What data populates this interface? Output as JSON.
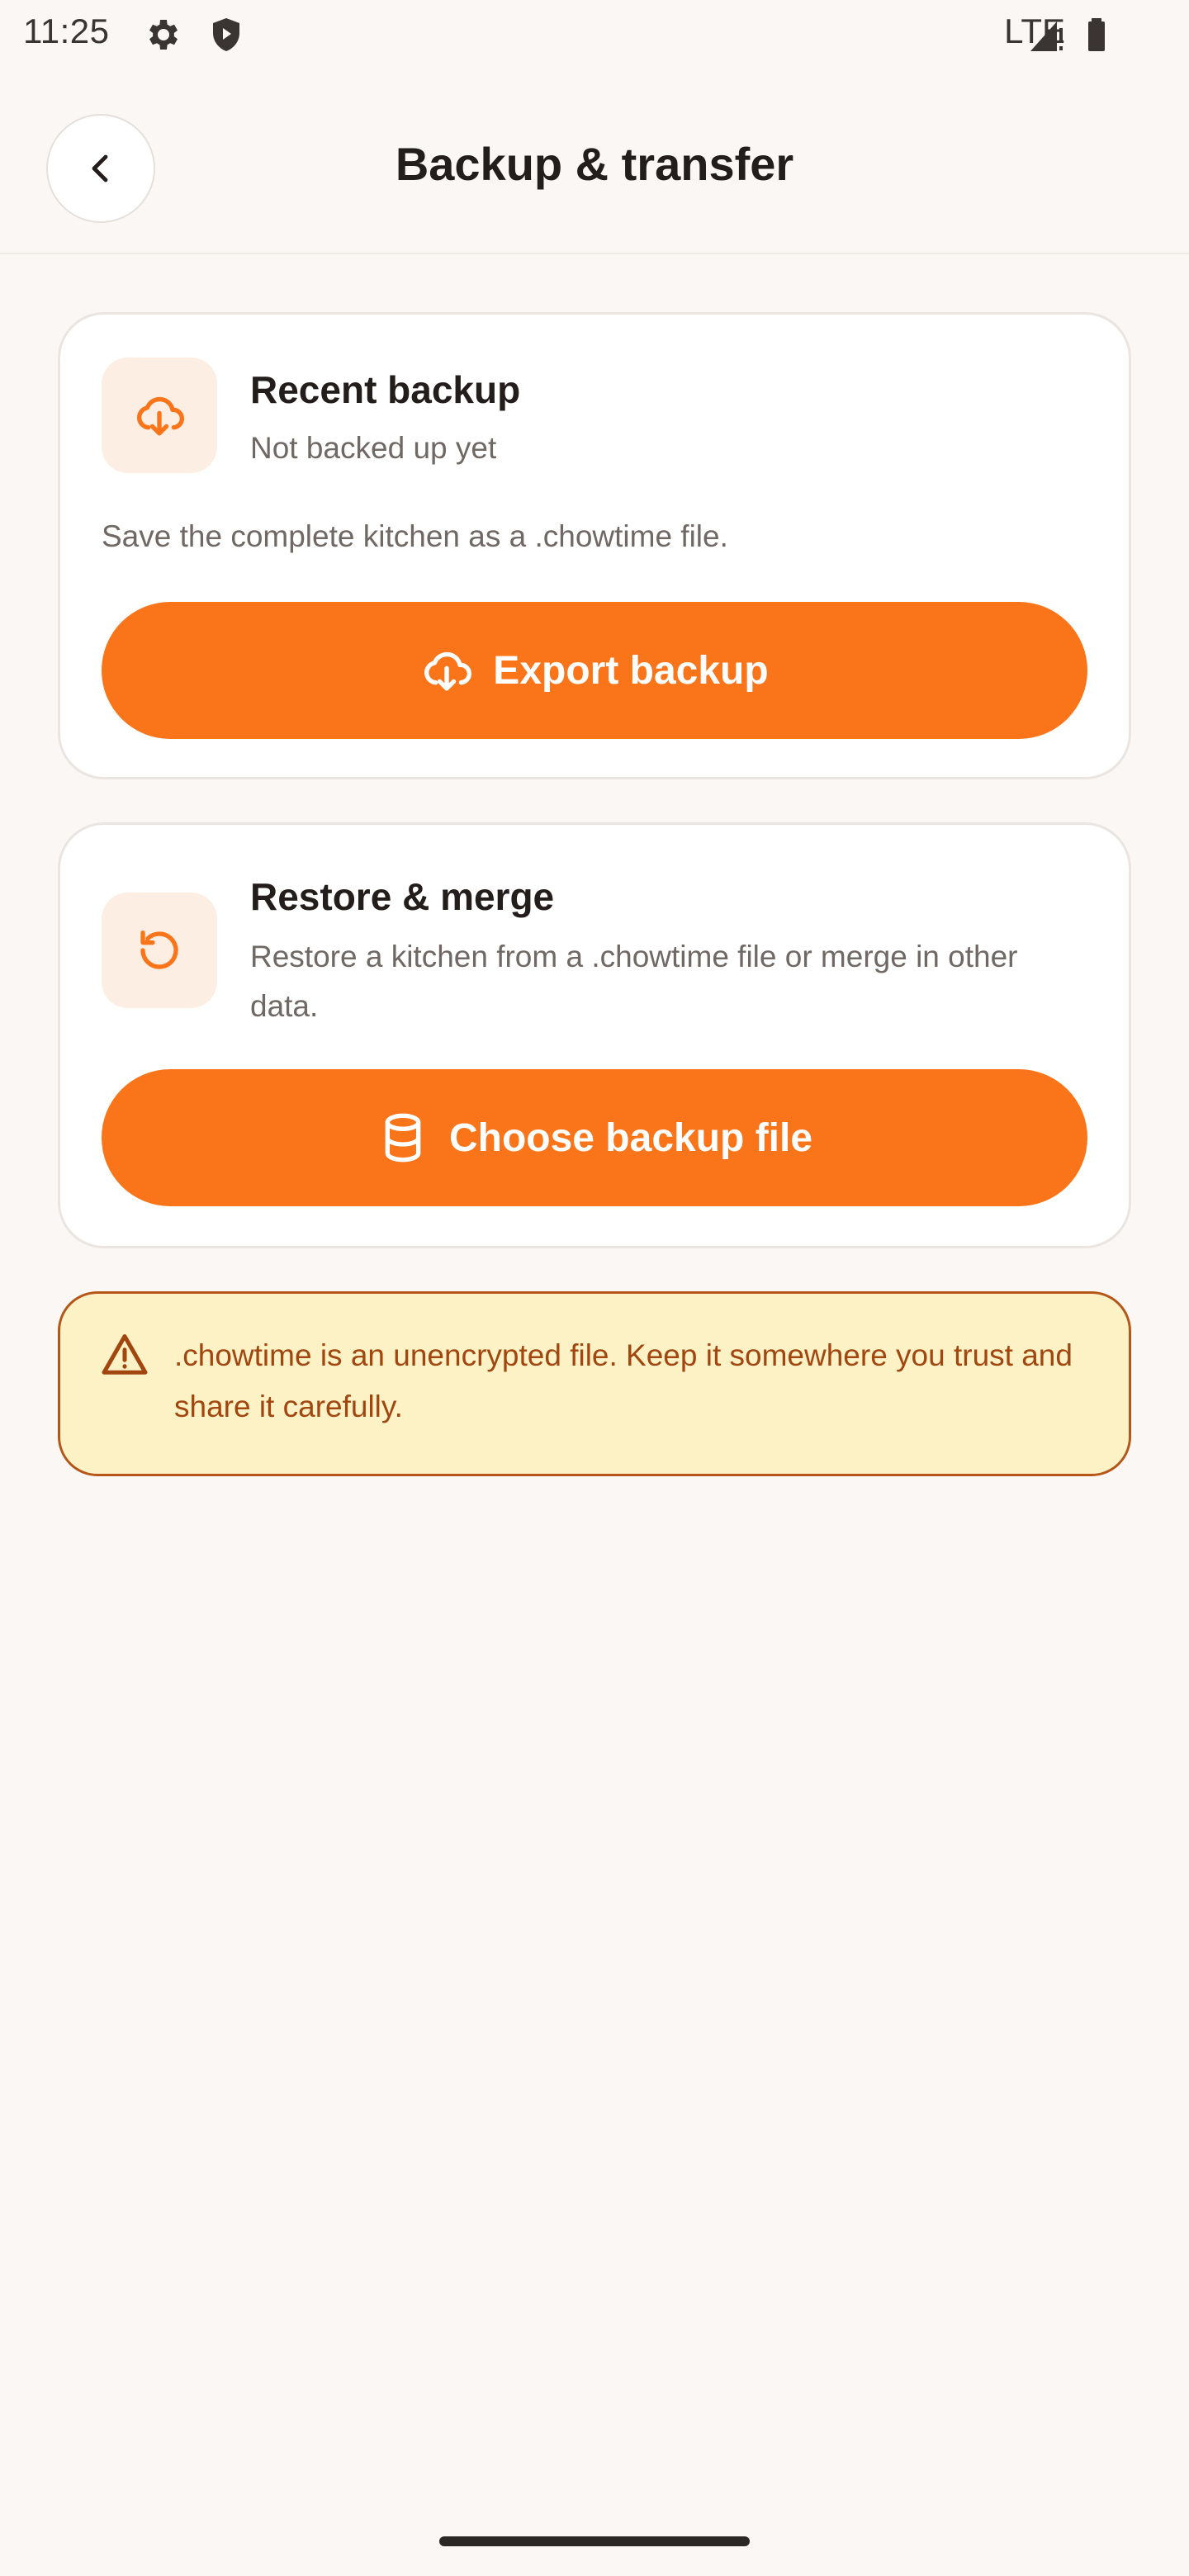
{
  "status_bar": {
    "time": "11:25",
    "network": "LTE",
    "icons": [
      "gear-icon",
      "shield-play-icon",
      "signal-icon",
      "battery-icon"
    ]
  },
  "header": {
    "title": "Backup & transfer",
    "back_icon": "chevron-left-icon"
  },
  "backup_card": {
    "title": "Recent backup",
    "status": "Not backed up yet",
    "description": "Save the complete kitchen as a .chowtime file.",
    "button_label": "Export backup",
    "icon": "cloud-download-icon"
  },
  "restore_card": {
    "title": "Restore & merge",
    "description": "Restore a kitchen from a .chowtime file or merge in other data.",
    "button_label": "Choose backup file",
    "icon": "restore-icon",
    "button_icon": "database-icon"
  },
  "warning": {
    "text": ".chowtime is an unencrypted file. Keep it somewhere you trust and share it carefully.",
    "icon": "warning-triangle-icon"
  },
  "colors": {
    "accent": "#fa7519",
    "icon_bg": "#fdeee4",
    "warning_bg": "#fdf2c6",
    "warning_border": "#b5571a",
    "warning_text": "#a1460f",
    "page_bg": "#fbf7f4"
  }
}
